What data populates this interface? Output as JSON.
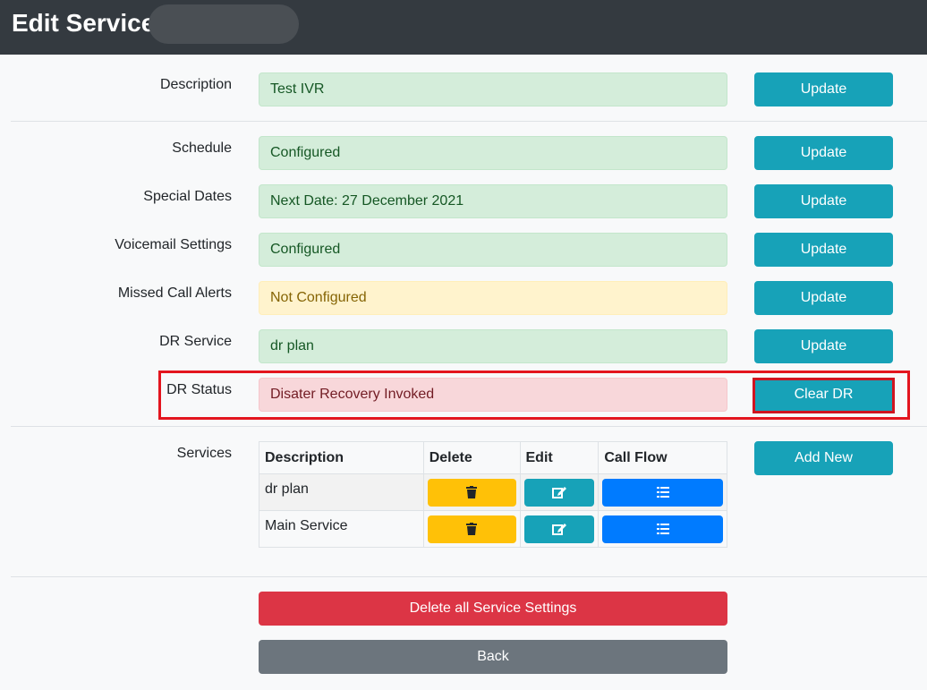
{
  "header": {
    "title": "Edit Service"
  },
  "rows": [
    {
      "label": "Description",
      "value": "Test IVR",
      "button": "Update"
    },
    {
      "label": "Schedule",
      "value": "Configured",
      "button": "Update"
    },
    {
      "label": "Special Dates",
      "value": "Next Date: 27 December 2021",
      "button": "Update"
    },
    {
      "label": "Voicemail Settings",
      "value": "Configured",
      "button": "Update"
    },
    {
      "label": "Missed Call Alerts",
      "value": "Not Configured",
      "button": "Update"
    },
    {
      "label": "DR Service",
      "value": "dr plan",
      "button": "Update"
    },
    {
      "label": "DR Status",
      "value": "Disater Recovery Invoked",
      "button": "Clear DR"
    }
  ],
  "services": {
    "label": "Services",
    "add_button": "Add New",
    "columns": [
      "Description",
      "Delete",
      "Edit",
      "Call Flow"
    ],
    "items": [
      {
        "description": "dr plan"
      },
      {
        "description": "Main Service"
      }
    ]
  },
  "actions": {
    "delete_all": "Delete all Service Settings",
    "back": "Back"
  },
  "colors": {
    "header_bg": "#343a40",
    "info": "#17a2b8",
    "warning": "#ffc107",
    "primary": "#007bff",
    "danger": "#dc3545",
    "secondary": "#6c757d",
    "highlight": "#e3151e"
  }
}
